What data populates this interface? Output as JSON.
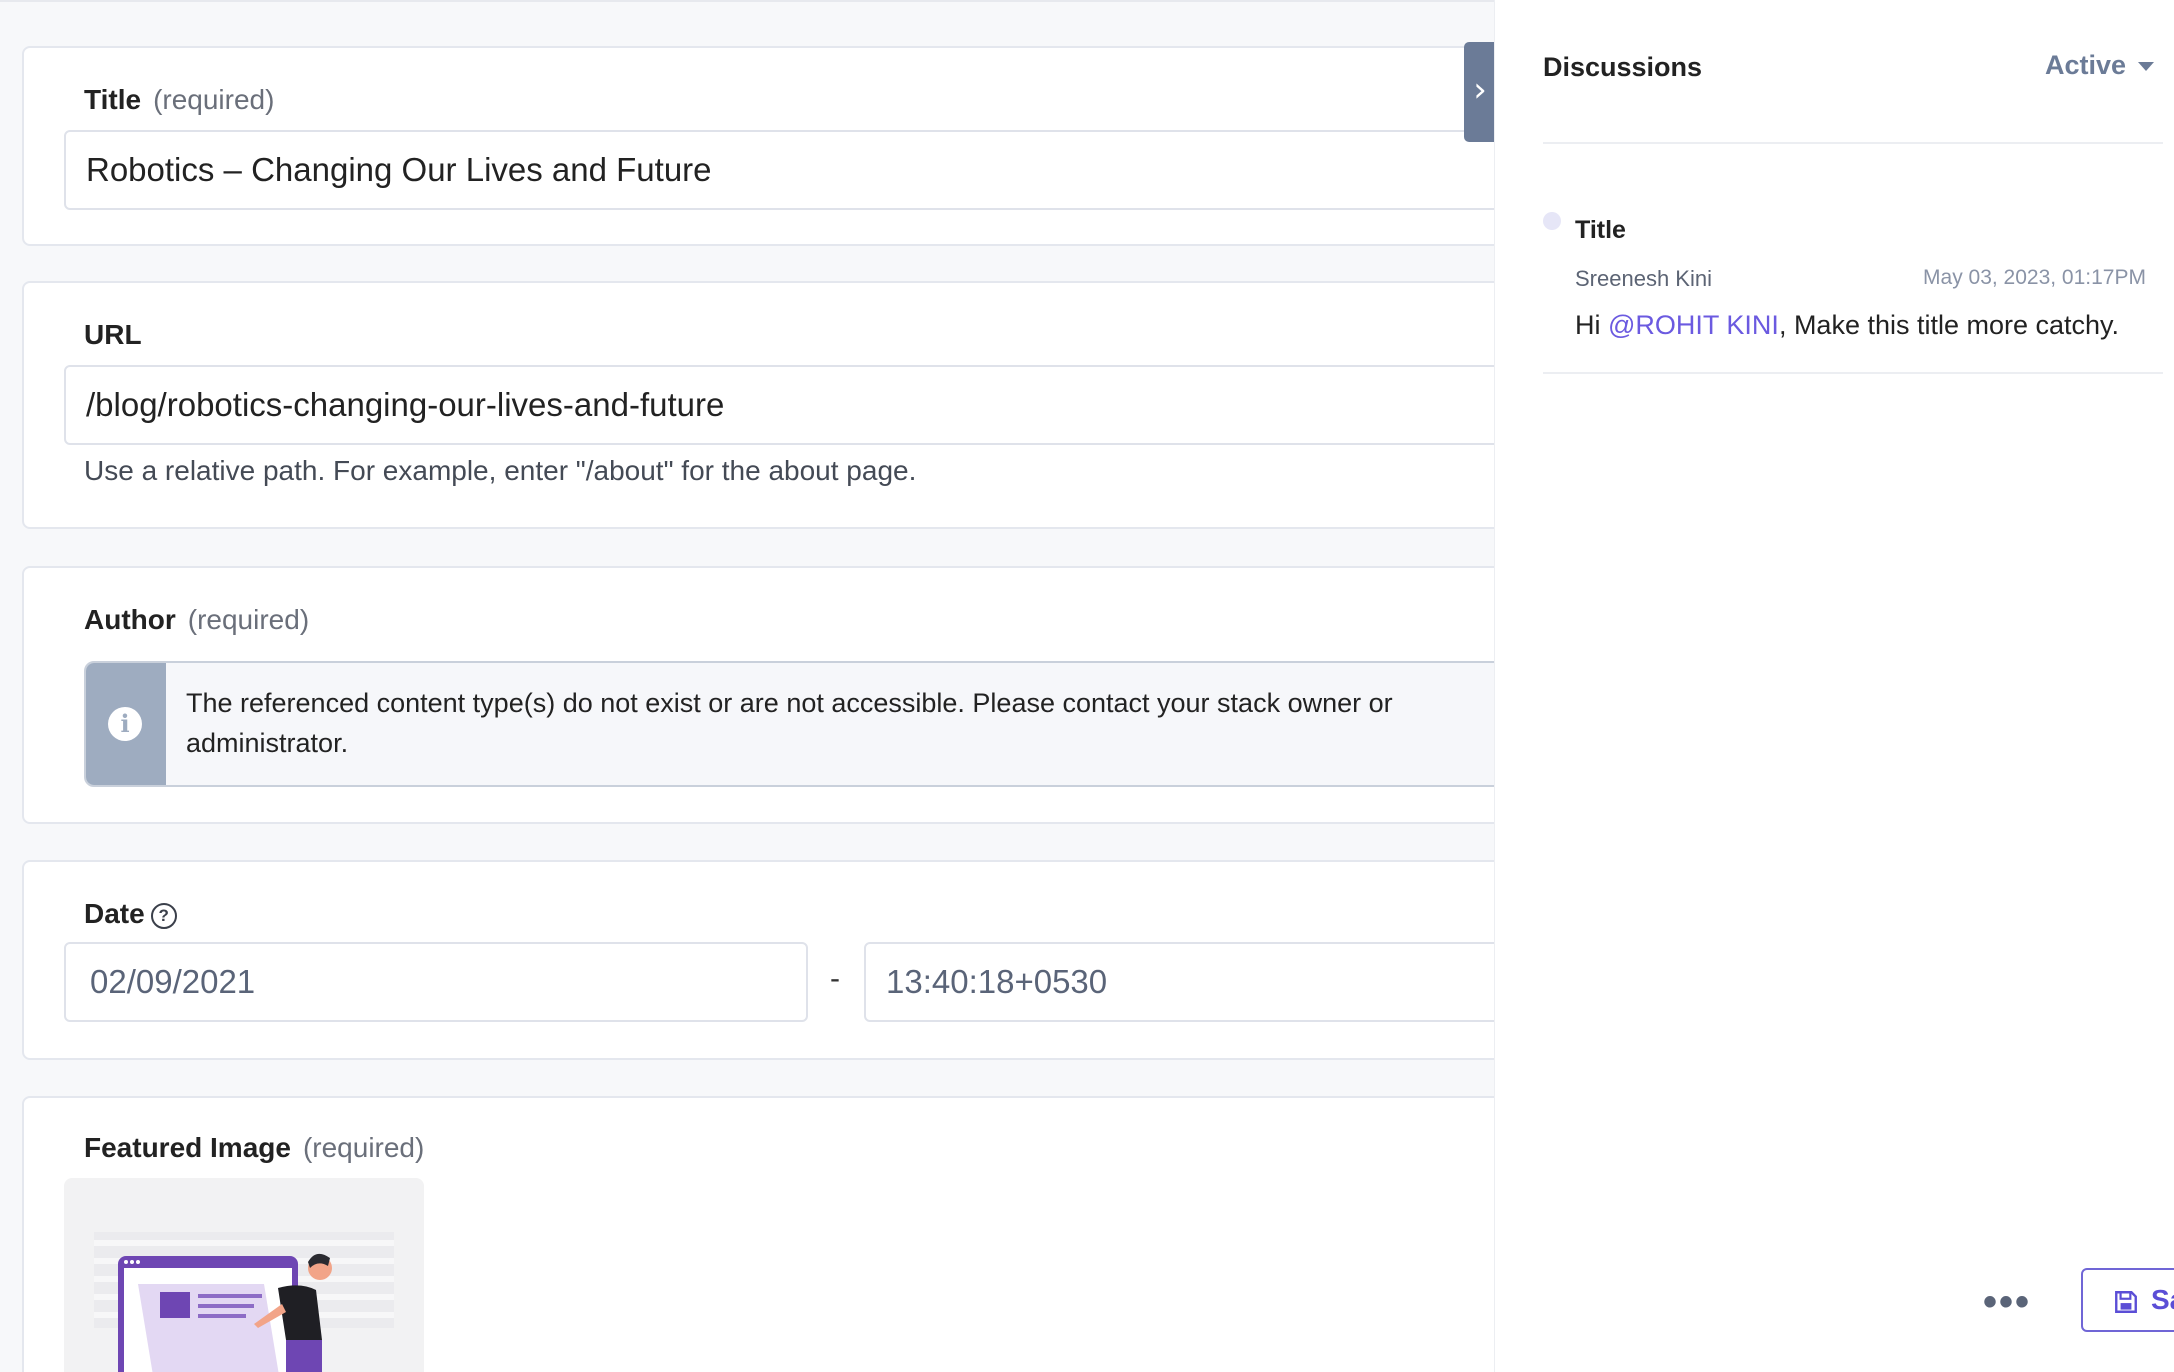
{
  "form": {
    "title_field": {
      "label": "Title",
      "required": "(required)",
      "value": "Robotics – Changing Our Lives and Future"
    },
    "url_field": {
      "label": "URL",
      "value": "/blog/robotics-changing-our-lives-and-future",
      "hint": "Use a relative path. For example, enter \"/about\" for the about page."
    },
    "author_field": {
      "label": "Author",
      "required": "(required)",
      "alert_line1": "The referenced content type(s) do not exist or are not accessible. Please contact your stack owner or",
      "alert_line2": "administrator."
    },
    "date_field": {
      "label": "Date",
      "date_value": "02/09/2021",
      "separator": "-",
      "time_value": "13:40:18+0530"
    },
    "featured_image_field": {
      "label": "Featured Image",
      "required": "(required)"
    }
  },
  "panel": {
    "title": "Discussions",
    "filter": "Active",
    "thread": {
      "title": "Title",
      "author": "Sreenesh Kini",
      "timestamp": "May 03, 2023, 01:17PM",
      "message_prefix": "Hi ",
      "mention": "@ROHIT KINI",
      "message_suffix": ", Make this title more catchy."
    },
    "more_label": "•••",
    "save_label": "Save"
  },
  "colors": {
    "accent": "#6b5ae0",
    "panel_tab": "#6b7b97",
    "alert_side": "#9eacc0"
  },
  "icons": [
    "chevron-right-icon",
    "info-icon",
    "help-circle-icon",
    "caret-down-icon",
    "save-icon",
    "more-icon"
  ]
}
